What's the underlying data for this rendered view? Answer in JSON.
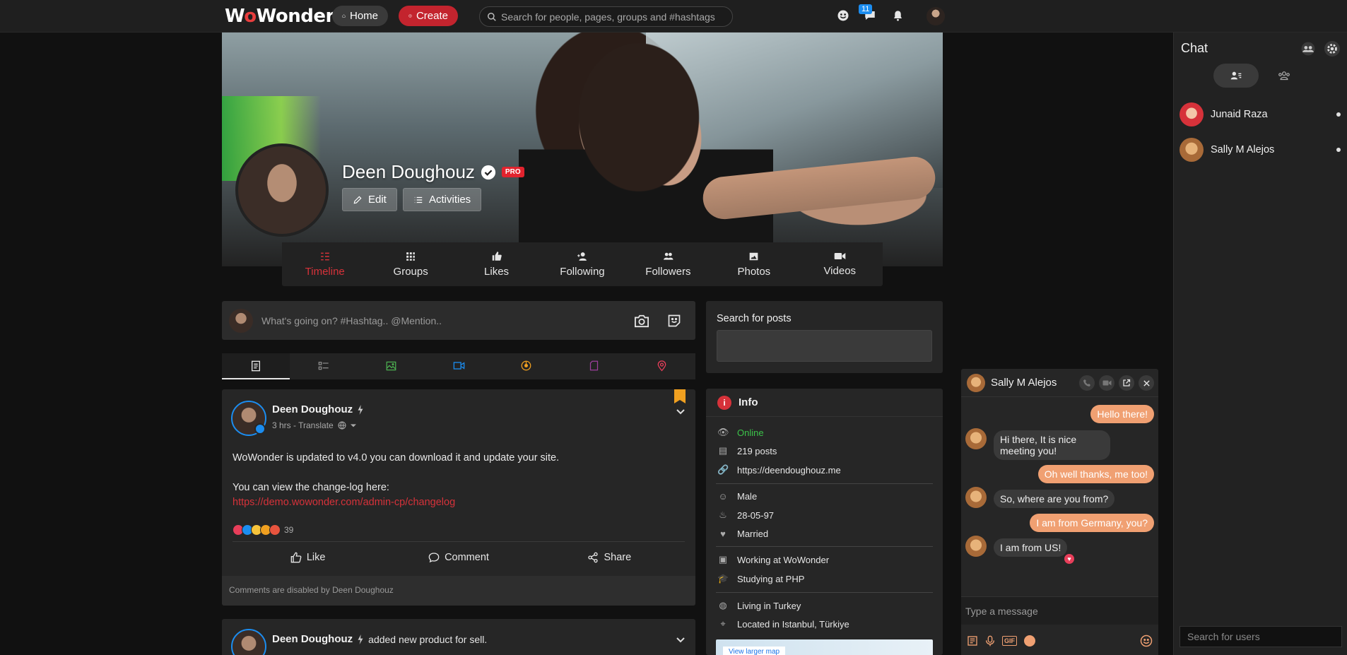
{
  "topbar": {
    "logo_prefix": "W",
    "logo_o": "o",
    "logo_suffix": "Wonder",
    "home_label": "Home",
    "create_label": "Create",
    "search_placeholder": "Search for people, pages, groups and #hashtags",
    "notification_count": "11"
  },
  "profile": {
    "name": "Deen Doughouz",
    "pro_badge": "PRO",
    "edit_label": "Edit",
    "activities_label": "Activities"
  },
  "profile_nav": [
    {
      "label": "Timeline",
      "icon": "timeline-icon"
    },
    {
      "label": "Groups",
      "icon": "groups-icon"
    },
    {
      "label": "Likes",
      "icon": "thumbs-up-icon"
    },
    {
      "label": "Following",
      "icon": "user-plus-icon"
    },
    {
      "label": "Followers",
      "icon": "users-icon"
    },
    {
      "label": "Photos",
      "icon": "image-icon"
    },
    {
      "label": "Videos",
      "icon": "video-icon"
    }
  ],
  "composer": {
    "placeholder": "What's going on? #Hashtag.. @Mention.."
  },
  "post": {
    "author": "Deen Doughouz",
    "meta": "3 hrs - Translate",
    "line1": "WoWonder is updated to v4.0 you can download it and update your site.",
    "line2": "You can view the change-log here:",
    "link": "https://demo.wowonder.com/admin-cp/changelog",
    "reaction_count": "39",
    "like_label": "Like",
    "comment_label": "Comment",
    "share_label": "Share",
    "footer": "Comments are disabled by Deen Doughouz"
  },
  "post2": {
    "author": "Deen Doughouz",
    "action": "added new product for sell."
  },
  "search_posts": {
    "label": "Search for posts"
  },
  "info": {
    "title": "Info",
    "status": "Online",
    "posts": "219 posts",
    "website": "https://deendoughouz.me",
    "gender": "Male",
    "birthday": "28-05-97",
    "relationship": "Married",
    "work": "Working at WoWonder",
    "study": "Studying at PHP",
    "living": "Living in Turkey",
    "located": "Located in Istanbul, Türkiye",
    "map_button": "View larger map"
  },
  "chat": {
    "title": "Chat",
    "users": [
      {
        "name": "Junaid Raza"
      },
      {
        "name": "Sally M Alejos"
      }
    ],
    "search_placeholder": "Search for users"
  },
  "chat_window": {
    "name": "Sally M Alejos",
    "messages": [
      {
        "dir": "out",
        "text": "Hello there!"
      },
      {
        "dir": "in",
        "text": "Hi there, It is nice meeting you!"
      },
      {
        "dir": "out",
        "text": "Oh well thanks, me too!"
      },
      {
        "dir": "in",
        "text": "So, where are you from?"
      },
      {
        "dir": "out",
        "text": "I am from Germany, you?"
      },
      {
        "dir": "in",
        "text": "I am from US!"
      }
    ],
    "input_placeholder": "Type a message",
    "gif_label": "GIF"
  },
  "colors": {
    "accent": "#d6323a",
    "link": "#d6323a",
    "online": "#3cc24a",
    "chat_out": "#f0a072"
  }
}
